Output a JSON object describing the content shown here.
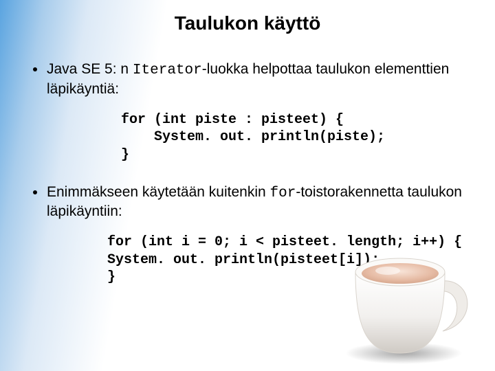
{
  "title": "Taulukon käyttö",
  "bullets": [
    {
      "pre": "Java SE 5: n ",
      "code": "Iterator",
      "post": "-luokka helpottaa taulukon elementtien läpikäyntiä:"
    },
    {
      "pre": "Enimmäkseen käytetään kuitenkin ",
      "code": "for",
      "post": "-toistorakennetta taulukon läpikäyntiin:"
    }
  ],
  "code1": "for (int piste : pisteet) {\n    System. out. println(piste);\n}",
  "code2": "for (int i = 0; i < pisteet. length; i++) {\nSystem. out. println(pisteet[i]);\n}"
}
